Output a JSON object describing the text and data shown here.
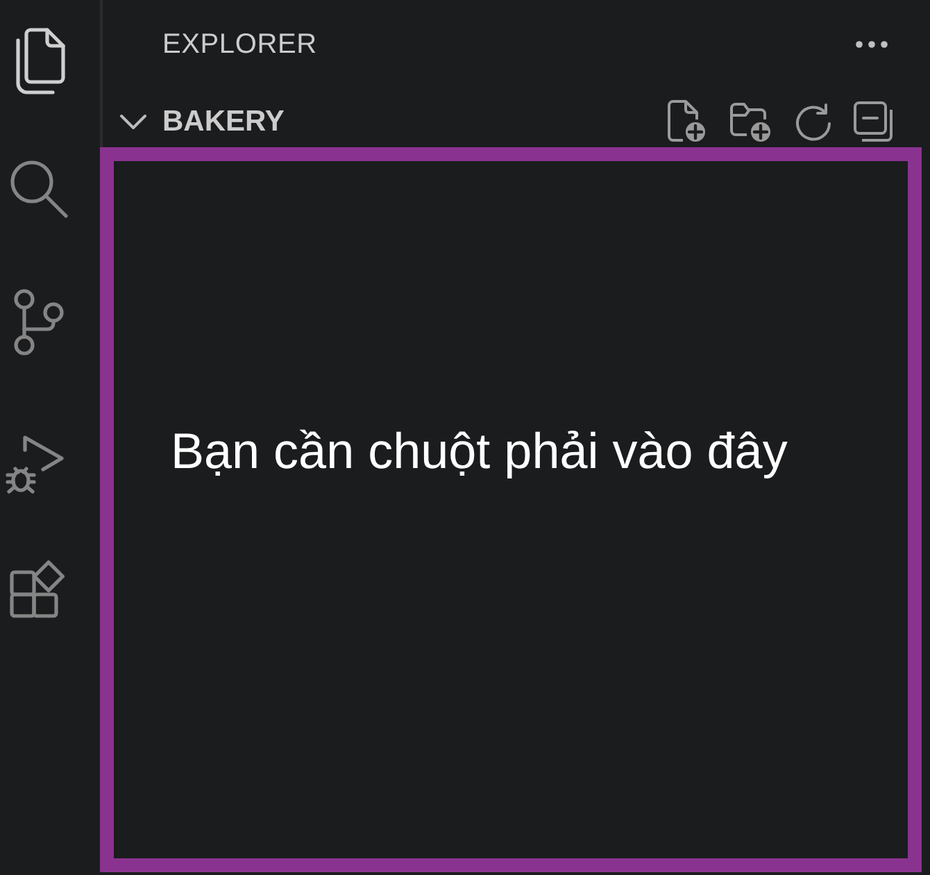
{
  "activity_bar": {
    "items": [
      {
        "kind": "files",
        "selected": true
      },
      {
        "kind": "search",
        "selected": false
      },
      {
        "kind": "source_control",
        "selected": false
      },
      {
        "kind": "run_debug",
        "selected": false
      },
      {
        "kind": "extensions",
        "selected": false
      }
    ]
  },
  "sidebar": {
    "title": "EXPLORER",
    "folder": {
      "name": "BAKERY",
      "expanded": true
    }
  },
  "annotation": {
    "text": "Bạn cần chuột phải vào đây"
  }
}
